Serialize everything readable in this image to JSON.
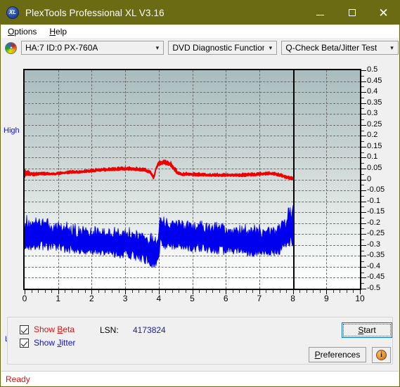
{
  "window": {
    "title": "PlexTools Professional XL V3.16",
    "icon": "XL",
    "minimize_label": "—",
    "maximize_label": "□",
    "close_label": "✕"
  },
  "menubar": {
    "items": [
      {
        "label": "Options",
        "accel": "O"
      },
      {
        "label": "Help",
        "accel": "H"
      }
    ]
  },
  "toolbar": {
    "disc_icon": "disc-icon",
    "drive_combo": {
      "value": "HA:7 ID:0  PX-760A",
      "arrow": "⌄"
    },
    "function_combo": {
      "value": "DVD Diagnostic Functions",
      "arrow": "⌄"
    },
    "test_combo": {
      "value": "Q-Check Beta/Jitter Test",
      "arrow": "⌄"
    }
  },
  "controls": {
    "show_beta": {
      "label_pre": "Show ",
      "label_accel": "B",
      "label_post": "eta",
      "checked": true,
      "color": "#e01010"
    },
    "show_jitter": {
      "label_pre": "Show ",
      "label_accel": "J",
      "label_post": "itter",
      "checked": true,
      "color": "#1212d0"
    },
    "lsn_label": "LSN:",
    "lsn_value": "4173824",
    "start_button": {
      "label_pre": "",
      "label_accel": "S",
      "label_post": "tart"
    },
    "preferences_button": {
      "label_pre": "",
      "label_accel": "P",
      "label_post": "references"
    },
    "info_button": {
      "glyph": "i"
    }
  },
  "statusbar": {
    "text": "Ready"
  },
  "chart_data": {
    "type": "line",
    "title": "Q-Check Beta/Jitter Test",
    "xlabel": "",
    "ylabel": "",
    "axis_high_label": "High",
    "axis_low_label": "Low",
    "grid": true,
    "xlim": [
      0,
      10
    ],
    "ylim": [
      -0.5,
      0.5
    ],
    "xticks": [
      0,
      1,
      2,
      3,
      4,
      5,
      6,
      7,
      8,
      9,
      10
    ],
    "xtick_labels": [
      "0",
      "1",
      "2",
      "3",
      "4",
      "5",
      "6",
      "7",
      "8",
      "9",
      "10"
    ],
    "yticks": [
      0.5,
      0.45,
      0.4,
      0.35,
      0.3,
      0.25,
      0.2,
      0.15,
      0.1,
      0.05,
      0,
      -0.05,
      -0.1,
      -0.15,
      -0.2,
      -0.25,
      -0.3,
      -0.35,
      -0.4,
      -0.45,
      -0.5
    ],
    "ytick_labels": [
      "0.5",
      "0.45",
      "0.4",
      "0.35",
      "0.3",
      "0.25",
      "0.2",
      "0.15",
      "0.1",
      "0.05",
      "0",
      "-0.05",
      "-0.1",
      "-0.15",
      "-0.2",
      "-0.25",
      "-0.3",
      "-0.35",
      "-0.4",
      "-0.45",
      "-0.5"
    ],
    "data_end_marker_x": 8,
    "series": [
      {
        "name": "Beta",
        "color": "#ee0000",
        "style": "band",
        "x": [
          0.0,
          0.05,
          0.15,
          0.3,
          0.5,
          0.8,
          1.1,
          1.4,
          1.7,
          2.0,
          2.3,
          2.6,
          2.9,
          3.1,
          3.3,
          3.55,
          3.75,
          3.85,
          3.92,
          4.0,
          4.15,
          4.35,
          4.55,
          4.7,
          4.85,
          5.0,
          5.3,
          5.6,
          5.9,
          6.2,
          6.5,
          6.8,
          7.0,
          7.2,
          7.35,
          7.5,
          7.65,
          7.8,
          7.95,
          8.0
        ],
        "upper": [
          0.05,
          0.04,
          0.032,
          0.03,
          0.032,
          0.03,
          0.034,
          0.04,
          0.04,
          0.046,
          0.05,
          0.052,
          0.055,
          0.055,
          0.054,
          0.052,
          0.04,
          0.014,
          0.06,
          0.082,
          0.086,
          0.08,
          0.04,
          0.03,
          0.03,
          0.03,
          0.028,
          0.026,
          0.026,
          0.026,
          0.026,
          0.028,
          0.03,
          0.033,
          0.033,
          0.03,
          0.024,
          0.017,
          0.012,
          0.012
        ],
        "lower": [
          0.0,
          0.02,
          0.018,
          0.018,
          0.02,
          0.02,
          0.024,
          0.028,
          0.03,
          0.034,
          0.038,
          0.04,
          0.042,
          0.042,
          0.04,
          0.038,
          0.026,
          0.0,
          0.04,
          0.066,
          0.07,
          0.062,
          0.024,
          0.018,
          0.018,
          0.018,
          0.016,
          0.014,
          0.014,
          0.014,
          0.014,
          0.016,
          0.018,
          0.021,
          0.021,
          0.018,
          0.012,
          0.005,
          0.0,
          0.0
        ]
      },
      {
        "name": "Jitter",
        "color": "#0000ee",
        "style": "band",
        "x": [
          0.0,
          0.1,
          0.25,
          0.45,
          0.65,
          0.85,
          1.05,
          1.25,
          1.5,
          1.75,
          2.0,
          2.25,
          2.5,
          2.75,
          3.0,
          3.25,
          3.45,
          3.6,
          3.72,
          3.82,
          3.9,
          3.96,
          4.0,
          4.05,
          4.2,
          4.4,
          4.6,
          4.8,
          5.0,
          5.25,
          5.5,
          5.75,
          6.0,
          6.25,
          6.5,
          6.75,
          7.0,
          7.25,
          7.45,
          7.6,
          7.75,
          7.85,
          7.93,
          8.0
        ],
        "upper": [
          -0.19,
          -0.2,
          -0.198,
          -0.205,
          -0.21,
          -0.215,
          -0.222,
          -0.228,
          -0.235,
          -0.242,
          -0.248,
          -0.25,
          -0.252,
          -0.252,
          -0.25,
          -0.252,
          -0.258,
          -0.265,
          -0.272,
          -0.28,
          -0.288,
          -0.292,
          -0.255,
          -0.185,
          -0.2,
          -0.208,
          -0.212,
          -0.215,
          -0.218,
          -0.222,
          -0.226,
          -0.23,
          -0.232,
          -0.235,
          -0.238,
          -0.24,
          -0.242,
          -0.24,
          -0.234,
          -0.224,
          -0.205,
          -0.18,
          -0.152,
          -0.15
        ],
        "lower": [
          -0.3,
          -0.305,
          -0.305,
          -0.302,
          -0.305,
          -0.308,
          -0.312,
          -0.318,
          -0.322,
          -0.325,
          -0.328,
          -0.332,
          -0.336,
          -0.34,
          -0.344,
          -0.348,
          -0.356,
          -0.366,
          -0.376,
          -0.386,
          -0.392,
          -0.39,
          -0.348,
          -0.292,
          -0.3,
          -0.302,
          -0.305,
          -0.308,
          -0.312,
          -0.315,
          -0.318,
          -0.322,
          -0.326,
          -0.33,
          -0.332,
          -0.334,
          -0.336,
          -0.334,
          -0.33,
          -0.322,
          -0.31,
          -0.296,
          -0.282,
          -0.28
        ]
      }
    ]
  }
}
